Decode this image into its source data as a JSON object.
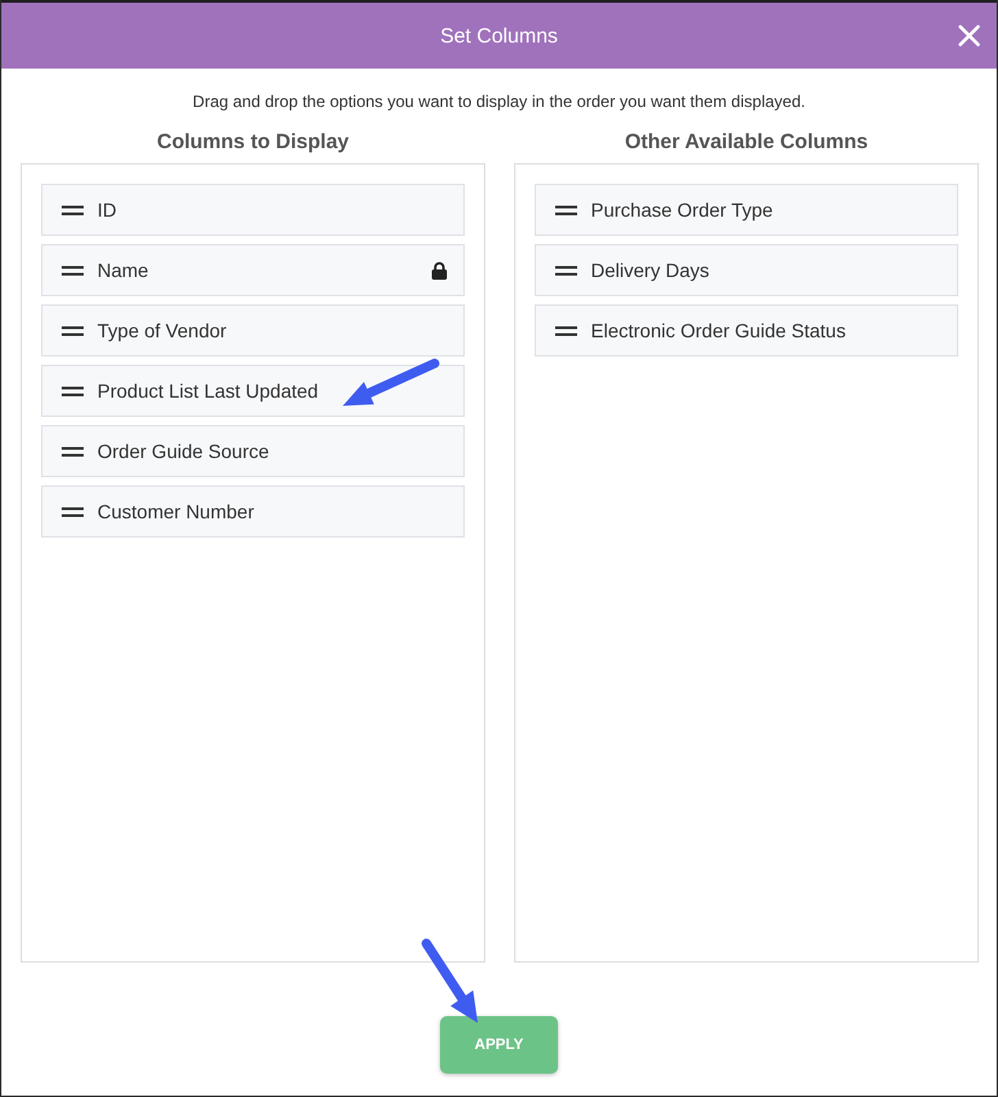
{
  "dialog": {
    "title": "Set Columns"
  },
  "instructions": "Drag and drop the options you want to display in the order you want them displayed.",
  "displayed": {
    "heading": "Columns to Display",
    "items": [
      {
        "label": "ID",
        "locked": false
      },
      {
        "label": "Name",
        "locked": true
      },
      {
        "label": "Type of Vendor",
        "locked": false
      },
      {
        "label": "Product List Last Updated",
        "locked": false
      },
      {
        "label": "Order Guide Source",
        "locked": false
      },
      {
        "label": "Customer Number",
        "locked": false
      }
    ]
  },
  "available": {
    "heading": "Other Available Columns",
    "items": [
      {
        "label": "Purchase Order Type"
      },
      {
        "label": "Delivery Days"
      },
      {
        "label": "Electronic Order Guide Status"
      }
    ]
  },
  "apply_button": {
    "label": "APPLY"
  }
}
